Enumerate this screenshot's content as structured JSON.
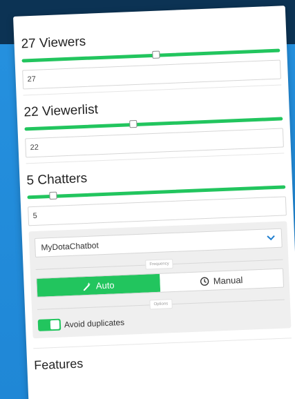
{
  "viewers": {
    "title": "27 Viewers",
    "value": "27",
    "level": 0.52
  },
  "viewerlist": {
    "title": "22 Viewerlist",
    "value": "22",
    "level": 0.42
  },
  "chatters": {
    "title": "5 Chatters",
    "value": "5",
    "level": 0.1
  },
  "chatbot": {
    "selected": "MyDotaChatbot",
    "frequency_label": "Frequency",
    "auto_label": "Auto",
    "manual_label": "Manual",
    "active_mode": "auto",
    "options_label": "Options",
    "avoid_duplicates_label": "Avoid duplicates",
    "avoid_duplicates_on": true
  },
  "features_title": "Features",
  "colors": {
    "accent_green": "#22c55e",
    "header_dark": "#0c3354",
    "background_blue": "#2590de"
  }
}
